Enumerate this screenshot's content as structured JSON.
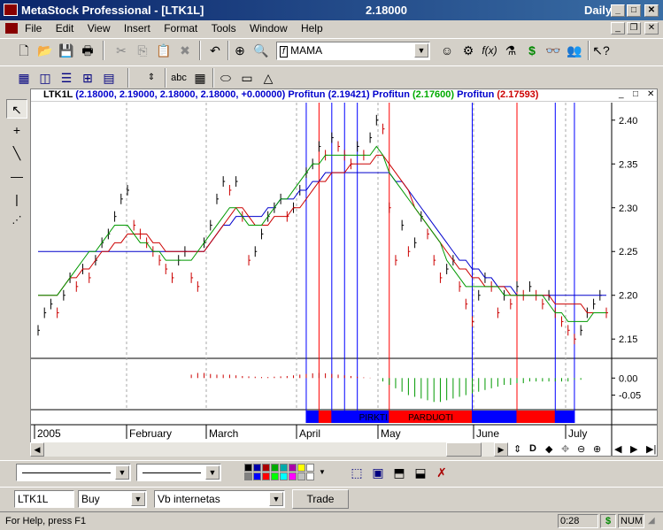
{
  "window": {
    "title": "MetaStock Professional - [LTK1L]",
    "price": "2.18000",
    "period": "Daily"
  },
  "menu": [
    "File",
    "Edit",
    "View",
    "Insert",
    "Format",
    "Tools",
    "Window",
    "Help"
  ],
  "toolbar": {
    "indicator_combo": "MAMA"
  },
  "drawing_toolbar": {
    "text_tool": "abc"
  },
  "chart_header": {
    "symbol": "LTK1L",
    "ohlc": "(2.18000, 2.19000, 2.18000, 2.18000, +0.00000)",
    "ind1_name": "Profitun",
    "ind1_value": "(2.19421)",
    "ind2_name": "Profitun",
    "ind2_value": "(2.17600)",
    "ind3_name": "Profitun",
    "ind3_value": "(2.17593)"
  },
  "bottom_panel": {
    "buy_label": "PIRKTI",
    "sell_label": "PARDUOTI"
  },
  "order_bar": {
    "symbol": "LTK1L",
    "side": "Buy",
    "account": "Vb internetas",
    "trade_button": "Trade"
  },
  "scroll_controls": {
    "d_label": "D"
  },
  "statusbar": {
    "help": "For Help, press F1",
    "time": "0:28",
    "money": "$",
    "num": "NUM"
  },
  "colors": {
    "price_up": "#000000",
    "price_down": "#cc0000",
    "profitun_blue": "#0000cc",
    "profitun_green": "#009900",
    "profitun_red": "#cc0000",
    "buy_band": "#0000ff",
    "sell_band": "#ff0000"
  },
  "chart_data": {
    "type": "line",
    "x_labels": [
      "2005",
      "February",
      "March",
      "April",
      "May",
      "June",
      "July"
    ],
    "y_ticks": [
      "2.40",
      "2.35",
      "2.30",
      "2.25",
      "2.20",
      "2.15"
    ],
    "ylim": [
      2.13,
      2.42
    ],
    "osc_ticks": [
      "0.00",
      "-0.05"
    ],
    "osc_lim": [
      -0.09,
      0.05
    ],
    "price": [
      2.16,
      2.18,
      2.19,
      2.18,
      2.2,
      2.22,
      2.21,
      2.23,
      2.22,
      2.24,
      2.26,
      2.27,
      2.29,
      2.31,
      2.32,
      2.28,
      2.27,
      2.26,
      2.25,
      2.24,
      2.23,
      2.22,
      2.24,
      2.25,
      2.22,
      2.21,
      2.26,
      2.28,
      2.31,
      2.33,
      2.32,
      2.33,
      2.29,
      2.24,
      2.25,
      2.27,
      2.29,
      2.3,
      2.31,
      2.29,
      2.3,
      2.32,
      2.34,
      2.35,
      2.37,
      2.36,
      2.38,
      2.37,
      2.36,
      2.35,
      2.37,
      2.36,
      2.38,
      2.4,
      2.39,
      2.3,
      2.24,
      2.28,
      2.25,
      2.26,
      2.29,
      2.27,
      2.24,
      2.22,
      2.23,
      2.24,
      2.21,
      2.19,
      2.17,
      2.2,
      2.22,
      2.21,
      2.18,
      2.2,
      2.19,
      2.21,
      2.2,
      2.21,
      2.2,
      2.19,
      2.2,
      2.18,
      2.17,
      2.16,
      2.15,
      2.16,
      2.18,
      2.19,
      2.2,
      2.18
    ],
    "blue": [
      2.25,
      2.25,
      2.25,
      2.25,
      2.25,
      2.25,
      2.25,
      2.25,
      2.25,
      2.25,
      2.25,
      2.25,
      2.25,
      2.25,
      2.25,
      2.25,
      2.25,
      2.25,
      2.25,
      2.25,
      2.25,
      2.25,
      2.25,
      2.25,
      2.25,
      2.25,
      2.25,
      2.26,
      2.27,
      2.28,
      2.28,
      2.29,
      2.29,
      2.29,
      2.29,
      2.29,
      2.3,
      2.3,
      2.31,
      2.31,
      2.31,
      2.32,
      2.32,
      2.33,
      2.33,
      2.34,
      2.34,
      2.34,
      2.34,
      2.34,
      2.34,
      2.34,
      2.34,
      2.34,
      2.34,
      2.34,
      2.33,
      2.33,
      2.32,
      2.31,
      2.3,
      2.29,
      2.28,
      2.27,
      2.26,
      2.25,
      2.24,
      2.24,
      2.23,
      2.23,
      2.22,
      2.22,
      2.21,
      2.21,
      2.21,
      2.2,
      2.2,
      2.2,
      2.2,
      2.2,
      2.2,
      2.2,
      2.2,
      2.2,
      2.2,
      2.2,
      2.2,
      2.2,
      2.2,
      2.2
    ],
    "red": [
      2.2,
      2.2,
      2.2,
      2.2,
      2.21,
      2.22,
      2.22,
      2.23,
      2.23,
      2.24,
      2.25,
      2.25,
      2.26,
      2.26,
      2.27,
      2.27,
      2.27,
      2.27,
      2.26,
      2.26,
      2.25,
      2.25,
      2.25,
      2.25,
      2.25,
      2.25,
      2.25,
      2.26,
      2.27,
      2.28,
      2.29,
      2.3,
      2.3,
      2.29,
      2.28,
      2.28,
      2.28,
      2.29,
      2.29,
      2.29,
      2.3,
      2.3,
      2.31,
      2.32,
      2.33,
      2.33,
      2.34,
      2.34,
      2.34,
      2.35,
      2.35,
      2.35,
      2.35,
      2.36,
      2.36,
      2.35,
      2.34,
      2.33,
      2.32,
      2.3,
      2.29,
      2.28,
      2.27,
      2.26,
      2.25,
      2.24,
      2.23,
      2.23,
      2.22,
      2.22,
      2.21,
      2.21,
      2.21,
      2.21,
      2.2,
      2.2,
      2.2,
      2.2,
      2.2,
      2.2,
      2.2,
      2.19,
      2.19,
      2.19,
      2.19,
      2.19,
      2.18,
      2.18,
      2.18,
      2.18
    ],
    "green": [
      2.2,
      2.2,
      2.2,
      2.2,
      2.21,
      2.22,
      2.23,
      2.24,
      2.25,
      2.25,
      2.26,
      2.27,
      2.28,
      2.28,
      2.28,
      2.27,
      2.26,
      2.26,
      2.25,
      2.25,
      2.24,
      2.24,
      2.24,
      2.24,
      2.24,
      2.25,
      2.26,
      2.27,
      2.28,
      2.29,
      2.3,
      2.3,
      2.29,
      2.28,
      2.28,
      2.28,
      2.29,
      2.3,
      2.31,
      2.31,
      2.32,
      2.33,
      2.34,
      2.35,
      2.35,
      2.36,
      2.36,
      2.36,
      2.36,
      2.36,
      2.36,
      2.36,
      2.36,
      2.37,
      2.36,
      2.34,
      2.33,
      2.32,
      2.31,
      2.3,
      2.29,
      2.28,
      2.27,
      2.26,
      2.24,
      2.23,
      2.22,
      2.21,
      2.21,
      2.21,
      2.21,
      2.21,
      2.21,
      2.2,
      2.2,
      2.2,
      2.2,
      2.2,
      2.2,
      2.2,
      2.19,
      2.18,
      2.18,
      2.17,
      2.17,
      2.17,
      2.17,
      2.18,
      2.18,
      2.18
    ],
    "oscillator": [
      0,
      0,
      0,
      0,
      0,
      0,
      0,
      0,
      0,
      0,
      0,
      0,
      0,
      0,
      0,
      0,
      0,
      0,
      0,
      0,
      0,
      0,
      0,
      0,
      0.01,
      0.015,
      0.015,
      0.012,
      0.01,
      0.01,
      0.01,
      0.008,
      0.006,
      0.005,
      0.004,
      0.003,
      0.003,
      0.004,
      0.005,
      0.006,
      0.008,
      0.01,
      0.012,
      0.014,
      0.015,
      0.014,
      0.012,
      0.01,
      0.008,
      0.006,
      0.004,
      0.002,
      0.001,
      0,
      -0.01,
      -0.02,
      -0.03,
      -0.04,
      -0.05,
      -0.055,
      -0.06,
      -0.065,
      -0.07,
      -0.07,
      -0.065,
      -0.06,
      -0.055,
      -0.05,
      -0.045,
      -0.04,
      -0.035,
      -0.03,
      -0.025,
      -0.02,
      -0.02,
      -0.015,
      -0.015,
      -0.01,
      -0.01,
      -0.01,
      -0.01,
      -0.01,
      -0.01,
      -0.01,
      -0.005,
      -0.005,
      0,
      0,
      0
    ],
    "signal_bars": [
      42,
      44,
      46,
      48,
      50,
      55,
      68,
      75,
      81,
      84
    ],
    "bands": [
      {
        "from": 42,
        "to": 44,
        "color": "blue"
      },
      {
        "from": 44,
        "to": 46,
        "color": "red"
      },
      {
        "from": 46,
        "to": 50,
        "color": "blue"
      },
      {
        "from": 50,
        "to": 55,
        "color": "blue",
        "label": "PIRKTI"
      },
      {
        "from": 55,
        "to": 68,
        "color": "red",
        "label": "PARDUOTI"
      },
      {
        "from": 68,
        "to": 75,
        "color": "blue"
      },
      {
        "from": 75,
        "to": 81,
        "color": "red"
      },
      {
        "from": 81,
        "to": 84,
        "color": "blue"
      }
    ]
  }
}
